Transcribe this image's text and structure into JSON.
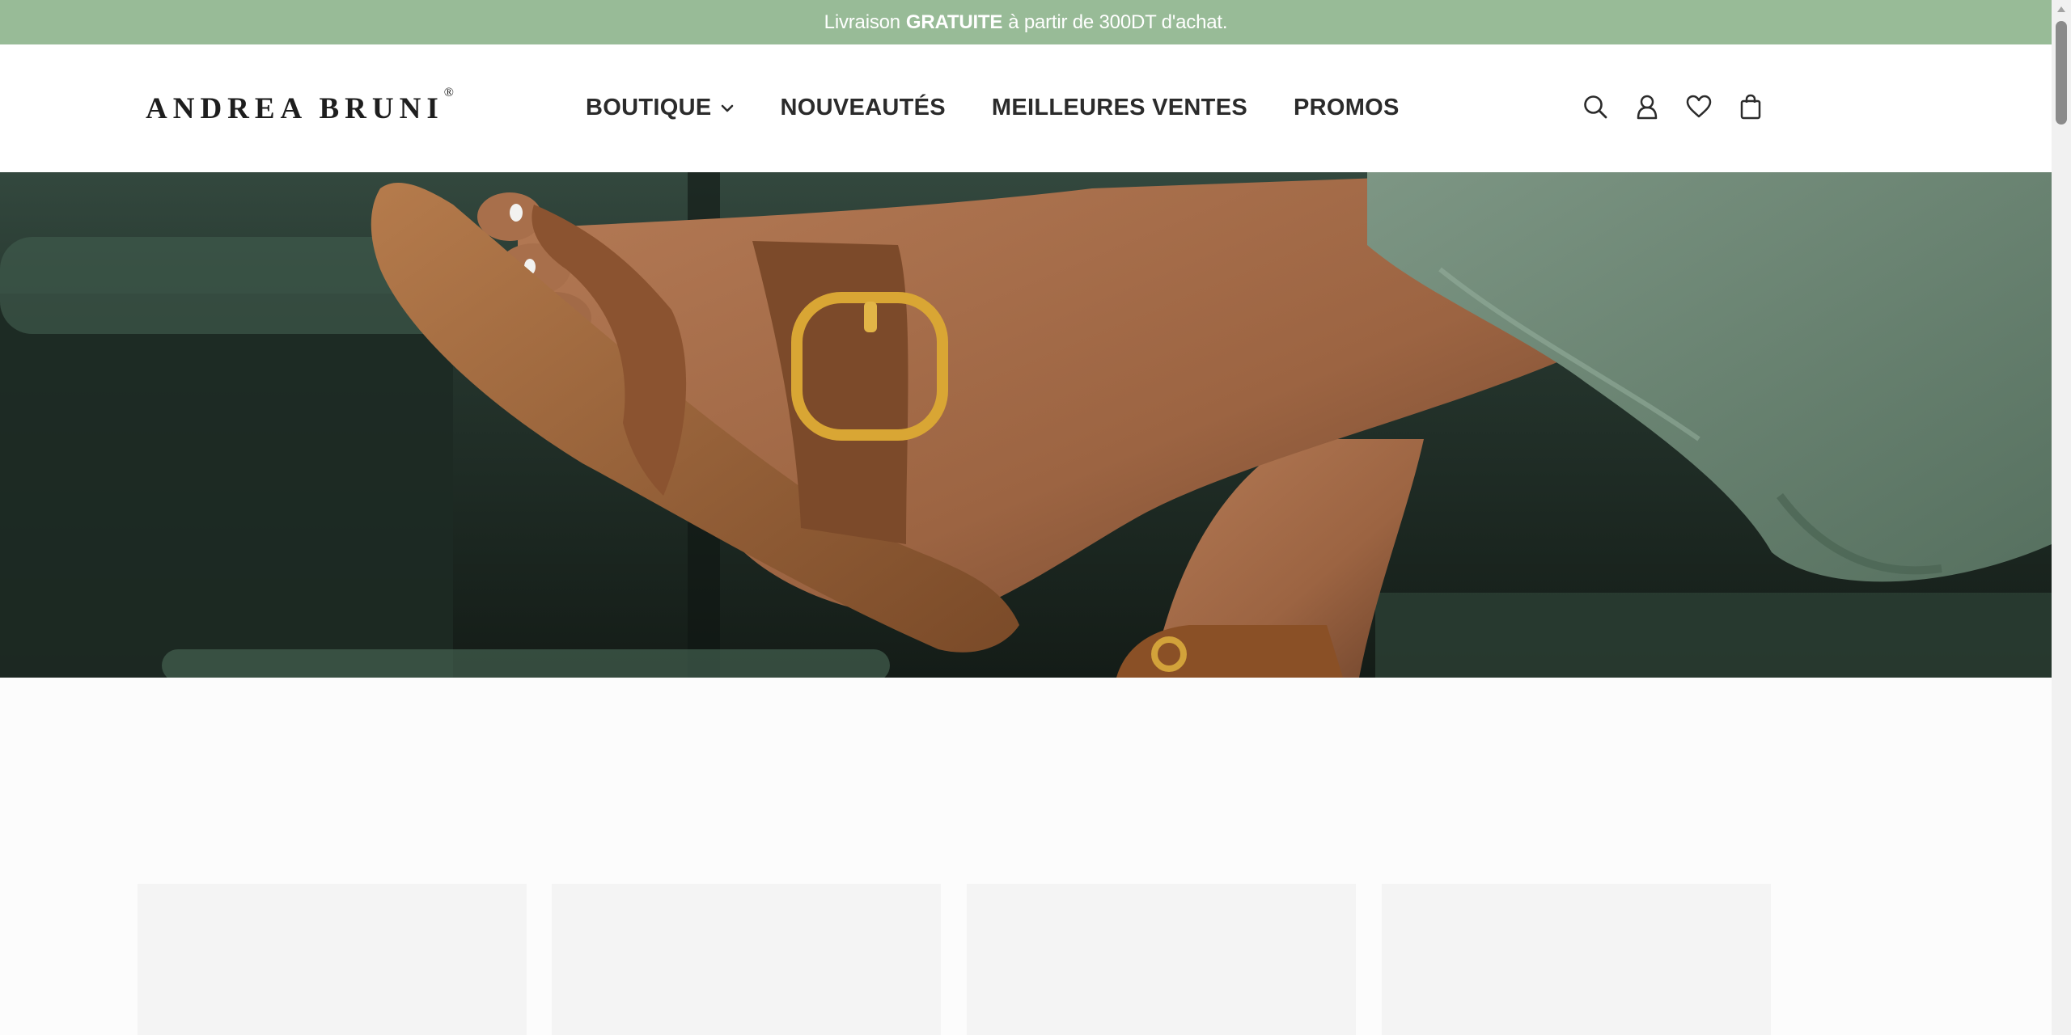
{
  "announcement": {
    "prefix": "Livraison",
    "highlight": "GRATUITE",
    "suffix": "à partir de 300DT d'achat."
  },
  "brand": {
    "name": "ANDREA BRUNI",
    "mark": "®"
  },
  "nav": {
    "items": [
      {
        "label": "BOUTIQUE",
        "has_dropdown": true
      },
      {
        "label": "NOUVEAUTÉS"
      },
      {
        "label": "MEILLEURES VENTES"
      },
      {
        "label": "PROMOS"
      }
    ]
  },
  "header_icons": [
    "search-icon",
    "account-icon",
    "wishlist-heart-icon",
    "shopping-bag-icon"
  ],
  "hero": {
    "image": "brown leather flat sandal with gold buckle on crossed legs, sage green trousers"
  },
  "product_cards": [
    {
      "state": "loading-placeholder"
    },
    {
      "state": "loading-placeholder"
    },
    {
      "state": "loading-placeholder"
    },
    {
      "state": "loading-placeholder"
    }
  ],
  "colors": {
    "announcement_bg": "#98bb97",
    "nav_text": "#2b2b2b",
    "placeholder": "#f4f4f4"
  }
}
